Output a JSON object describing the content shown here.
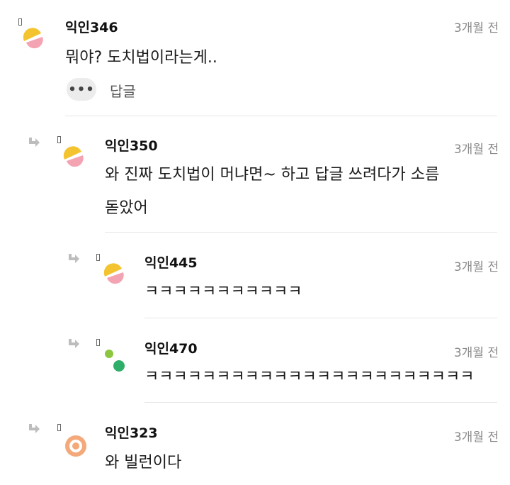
{
  "comments": [
    {
      "author": "익인346",
      "time": "3개월 전",
      "lines": [
        "뭐야? 도치법이라는게.."
      ],
      "avatar": "yellow-pink",
      "more_label": "•••",
      "reply_label": "답글"
    },
    {
      "author": "익인350",
      "time": "3개월 전",
      "lines": [
        "와 진짜 도치법이 머냐면~ 하고 답글 쓰려다가 소름",
        "돋았어"
      ],
      "avatar": "yellow-pink"
    },
    {
      "author": "익인445",
      "time": "3개월 전",
      "lines": [
        "ㅋㅋㅋㅋㅋㅋㅋㅋㅋㅋㅋ"
      ],
      "avatar": "yellow-pink"
    },
    {
      "author": "익인470",
      "time": "3개월 전",
      "lines": [
        "ㅋㅋㅋㅋㅋㅋㅋㅋㅋㅋㅋㅋㅋㅋㅋㅋㅋㅋㅋㅋㅋㅋㅋ"
      ],
      "avatar": "green-dots"
    },
    {
      "author": "익인323",
      "time": "3개월 전",
      "lines": [
        "와 빌런이다"
      ],
      "avatar": "orange-ring"
    }
  ],
  "colors": {
    "yellow": "#f4c430",
    "pink": "#f4a3b2",
    "green_light": "#8cc63f",
    "green_dark": "#2fae6a",
    "orange": "#f4a97a"
  }
}
